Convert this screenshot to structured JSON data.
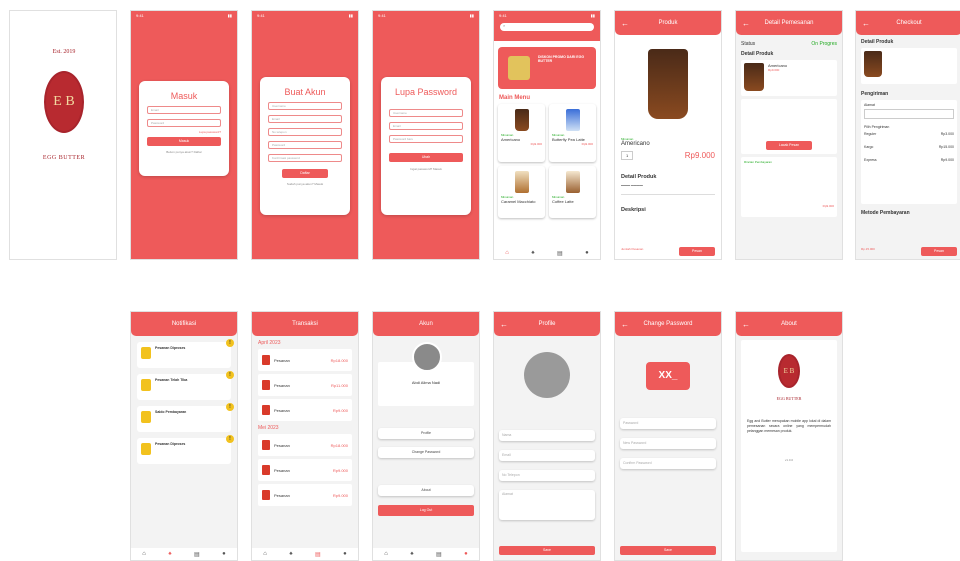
{
  "splash": {
    "est": "Est. 2019",
    "mono": "E B",
    "brand": "EGG BUTTER"
  },
  "login": {
    "title": "Masuk",
    "email": "Email",
    "password": "Password",
    "forgot": "Lupa password?",
    "button": "Masuk",
    "signup": "Belum punya akun? Daftar"
  },
  "register": {
    "title": "Buat Akun",
    "fields": [
      "Username",
      "Email",
      "No telepon",
      "Password",
      "Konfirmasi password"
    ],
    "button": "Daftar",
    "login": "Sudah punya akun? Masuk"
  },
  "forgot": {
    "title": "Lupa Password",
    "fields": [
      "Username",
      "Email",
      "Password baru"
    ],
    "button": "Ubah",
    "login": "Ingat password? Masuk"
  },
  "home": {
    "promo": "DISKON PROMO DARI EGG BUTTER",
    "menu_title": "Main Menu",
    "items": [
      {
        "cat": "Minuman",
        "name": "Americano",
        "price": "Rp9.000"
      },
      {
        "cat": "Minuman",
        "name": "Butterfly Pea Latte",
        "price": "Rp9.000"
      },
      {
        "cat": "Minuman",
        "name": "Caramel Macchiato",
        "price": "Rp9.000"
      },
      {
        "cat": "Minuman",
        "name": "Coffee Latte",
        "price": "Rp9.000"
      }
    ]
  },
  "product": {
    "header": "Produk",
    "category": "Minuman",
    "name": "Americano",
    "price": "Rp9.000",
    "qty": "1",
    "detail_title": "Detail Produk",
    "desc_title": "Deskripsi",
    "total_label": "Jumlah Pesanan",
    "button": "Pesan"
  },
  "order_detail": {
    "header": "Detail Pemesanan",
    "status_label": "Status",
    "status": "On Progres",
    "detail_title": "Detail Produk",
    "item": "Americano",
    "price": "Rp9.000",
    "payment_title": "Rincian Pembayaran",
    "total": "Rp9.000",
    "button": "Lacak Pesan"
  },
  "checkout": {
    "header": "Checkout",
    "detail_title": "Detail Produk",
    "shipping_title": "Pengiriman",
    "address_label": "Alamat",
    "choose": "Pilih Pengiriman",
    "options": [
      {
        "name": "Reguler",
        "price": "Rp3.000"
      },
      {
        "name": "Kargo",
        "price": "Rp15.000"
      },
      {
        "name": "Express",
        "price": "Rp9.000"
      }
    ],
    "payment_title": "Metode Pembayaran",
    "total": "Rp.15.000",
    "button": "Pesan"
  },
  "notif": {
    "header": "Notifikasi",
    "items": [
      "Pesanan Diproses",
      "Pesanan Telah Tiba",
      "Saldo Pembayaran",
      "Pesanan Diproses"
    ]
  },
  "transaksi": {
    "header": "Transaksi",
    "months": [
      "April 2023",
      "Mei 2023"
    ],
    "label": "Pesanan",
    "prices": [
      "Rp18.000",
      "Rp11.000",
      "Rp9.000",
      "Rp18.000",
      "Rp9.000",
      "Rp9.000"
    ]
  },
  "akun": {
    "header": "Akun",
    "name": "Abdi Alima Nadi",
    "buttons": [
      "Profile",
      "Change Password",
      "About",
      "Log Out"
    ]
  },
  "profile": {
    "header": "Profile",
    "fields": [
      "Nama",
      "Email",
      "No Telepon",
      "Alamat"
    ],
    "button": "Save"
  },
  "changepw": {
    "header": "Change Password",
    "fields": [
      "Password",
      "New Password",
      "Confirm Password"
    ],
    "button": "Save",
    "icon": "XX_"
  },
  "about": {
    "header": "About",
    "text": "Egg and Butter merupakan mobile app lokal di dalam pemesanan secara online yang mempermudah pelanggan memesan produk.",
    "version": "v1.0.0"
  }
}
